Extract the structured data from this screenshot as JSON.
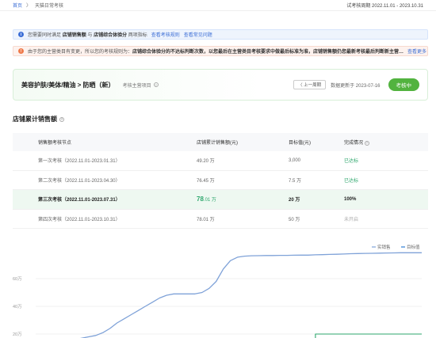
{
  "breadcrumb": {
    "home": "首页",
    "sep": "〉",
    "current": "天猫日常考核"
  },
  "period": "试考核周期 2022.11.01 - 2023.10.31",
  "info_notice": {
    "pre": "您需要同时满足",
    "metric1": "店铺销售额",
    "mid": "与",
    "metric2": "店铺综合体验分",
    "post": "两项指标",
    "link1": "查看考核规则",
    "link2": "查看常见问题"
  },
  "warn_notice": {
    "pre": "由于您的主营类目有变更，所以您的考核规则为：",
    "bold": "店铺综合体验分的不达标判断次数，以您最后在主营类目考核要求中做最后标准为准，店铺销售额仍您最新考核最后判断新主营…",
    "link": "查看更多"
  },
  "category": {
    "name": "美容护肤/美体/精油 > 防晒（新）",
    "target_label": "考核主营项目",
    "prev_label": "〈 上一周期",
    "updated": "数据更新于 2023-07-16",
    "status": "考核中"
  },
  "section_title": "店铺累计销售额",
  "table": {
    "headers": [
      "销售额考核节点",
      "店铺累计销售额(元)",
      "目标值(元)",
      "完成情况"
    ],
    "rows": [
      {
        "node": "第一次考核（2022.11.01-2023.01.31）",
        "amount": "49.20 万",
        "target": "3,000",
        "status": "已达标"
      },
      {
        "node": "第二次考核（2022.11.01-2023.04.30）",
        "amount": "76.45 万",
        "target": "7.5 万",
        "status": "已达标"
      },
      {
        "node": "第三次考核（2022.11.01-2023.07.31）",
        "amount_main": "78",
        "amount_frac": ".01 万",
        "target": "20 万",
        "status": "100%"
      },
      {
        "node": "第四次考核（2022.11.01-2023.10.31）",
        "amount": "78.01 万",
        "target": "50 万",
        "status": "未开启"
      }
    ]
  },
  "colors": {
    "accent": "#3d6fd6",
    "green": "#2ea76d",
    "status_green": "#52b33f",
    "line_blue": "#7fa2d8"
  },
  "chart_data": {
    "type": "line",
    "legend": [
      "实销售",
      "目标值"
    ],
    "legend_placement": "top-right",
    "ytick_labels": [
      "60万",
      "40万",
      "20万"
    ],
    "yticks": [
      60,
      40,
      20
    ],
    "ylim": [
      0,
      80
    ],
    "grid": true,
    "series": [
      {
        "name": "实销售",
        "values": [
          15,
          16,
          17,
          18,
          19,
          21,
          24,
          28,
          31,
          34,
          37,
          40,
          43,
          46,
          48,
          49,
          49,
          49,
          49,
          50,
          53,
          58,
          67,
          73,
          75.5,
          76.2,
          76.5,
          76.6,
          76.7,
          76.7,
          76.8,
          76.8,
          76.9,
          77,
          77,
          77.2,
          77.3,
          77.5,
          77.6,
          77.8,
          78,
          78.1,
          78.2,
          78.3,
          78.4,
          78.5,
          78.6,
          78.7,
          78.7,
          78.7,
          78.7
        ]
      },
      {
        "name": "目标值",
        "values": [
          null,
          null,
          null,
          null,
          null,
          null,
          null,
          null,
          null,
          null,
          null,
          null,
          null,
          null,
          null,
          null,
          null,
          null,
          null,
          null,
          null,
          null,
          null,
          null,
          null,
          null,
          null,
          null,
          null,
          null,
          null,
          null,
          null,
          null,
          null,
          20,
          20,
          20,
          20,
          20,
          20,
          20,
          20,
          20,
          20,
          20,
          20,
          20,
          20,
          20,
          20
        ]
      }
    ]
  }
}
